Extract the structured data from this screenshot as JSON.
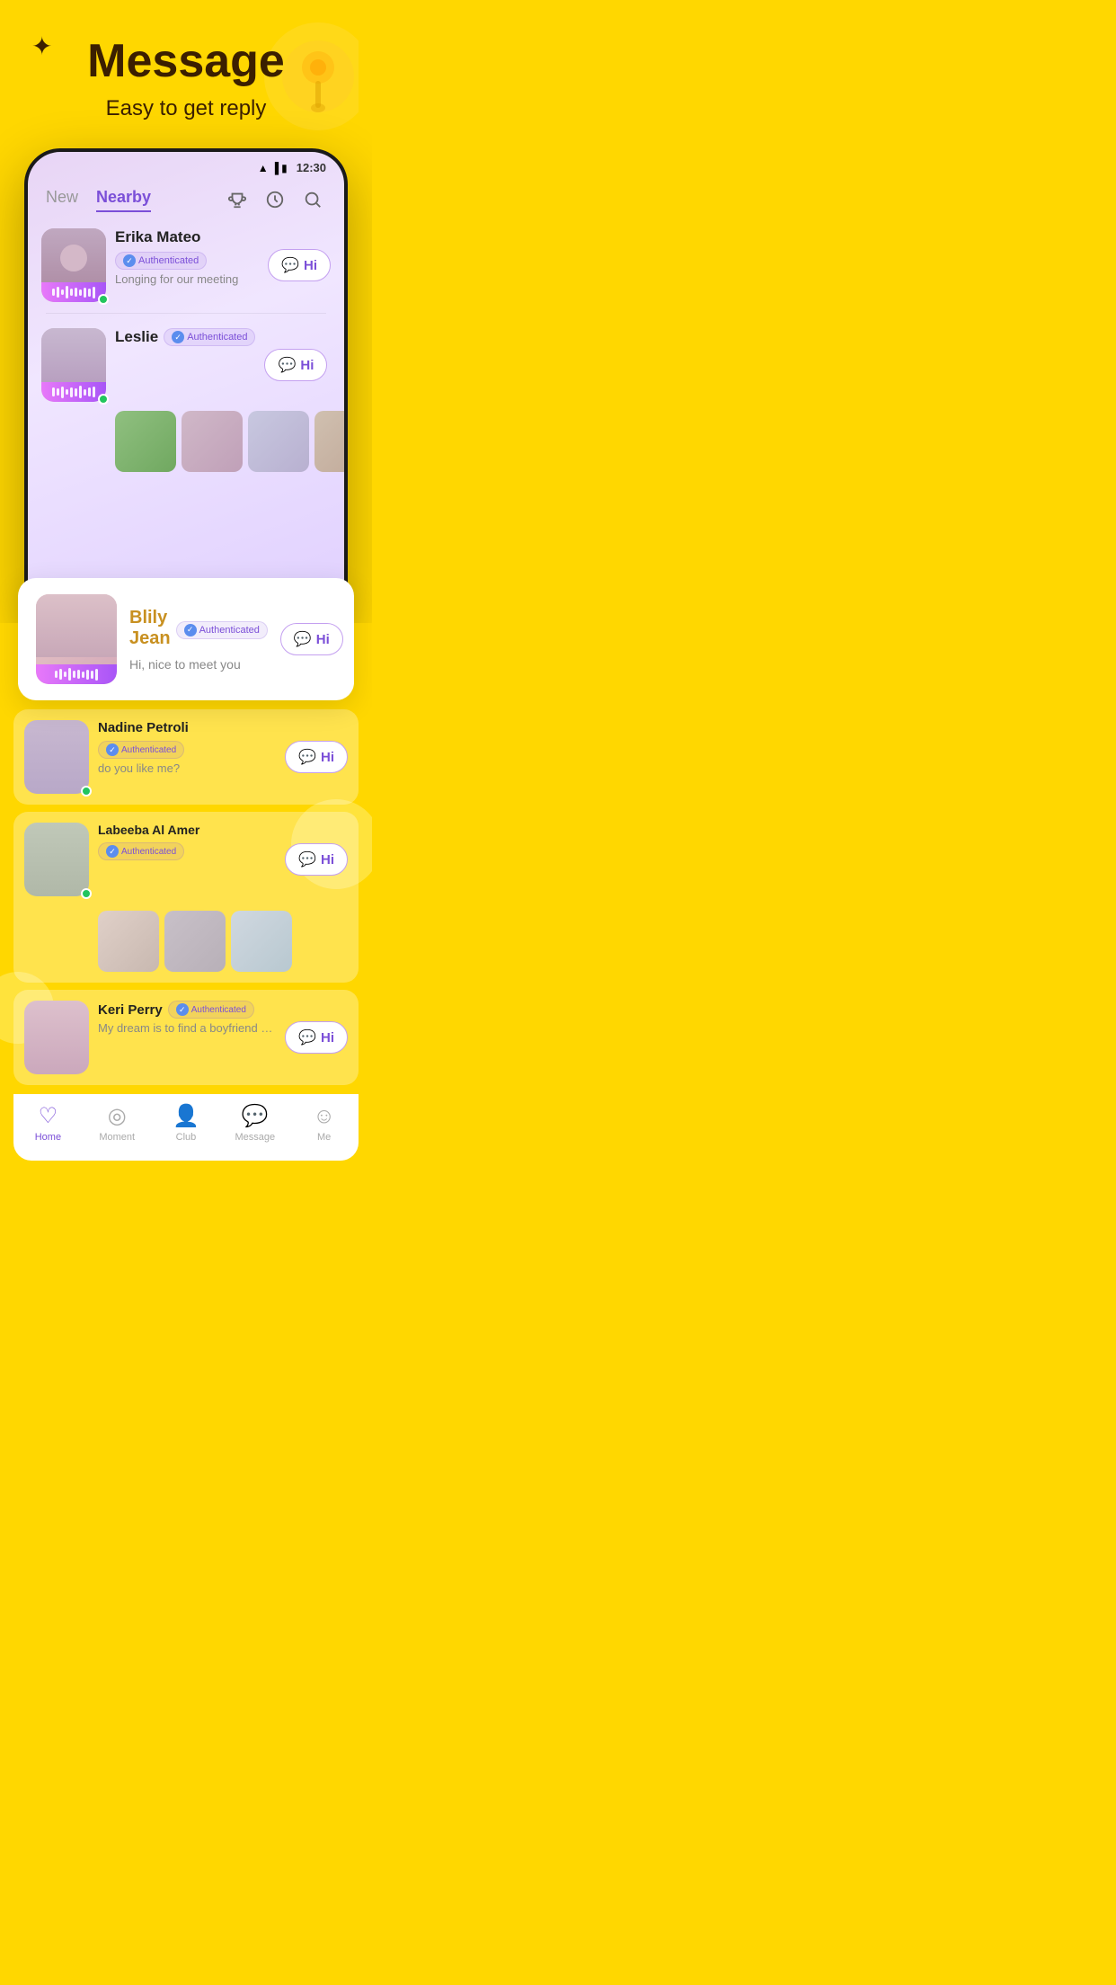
{
  "hero": {
    "title": "Message",
    "subtitle": "Easy to get reply"
  },
  "status_bar": {
    "time": "12:30",
    "wifi": "▲",
    "signal": "▐",
    "battery": "🔋"
  },
  "tabs": {
    "items": [
      {
        "label": "New",
        "active": false
      },
      {
        "label": "Nearby",
        "active": true
      }
    ],
    "icons": [
      "trophy",
      "clock",
      "search"
    ]
  },
  "users": [
    {
      "name": "Erika Mateo",
      "authenticated": true,
      "status": "Longing for our meeting",
      "online": true,
      "has_photos": false,
      "avatar_color": "linear-gradient(135deg, #d4b8c8, #c8a0b5)"
    },
    {
      "name": "Leslie",
      "authenticated": true,
      "status": "",
      "online": true,
      "has_photos": true,
      "avatar_color": "linear-gradient(135deg, #e0c8d8, #c8b0c8)"
    },
    {
      "name": "Blily Jean",
      "authenticated": true,
      "status": "Hi, nice to meet you",
      "online": false,
      "has_photos": false,
      "floating": true,
      "avatar_color": "linear-gradient(135deg, #e8c8c8, #d4a8b0)"
    },
    {
      "name": "Nadine Petroli",
      "authenticated": true,
      "status": "do you like me?",
      "online": true,
      "has_photos": false,
      "avatar_color": "linear-gradient(135deg, #c8c8e0, #b8b0d0)"
    },
    {
      "name": "Labeeba Al Amer",
      "authenticated": true,
      "status": "",
      "online": true,
      "has_photos": true,
      "avatar_color": "linear-gradient(135deg, #c8d4c8, #b0c4b0)"
    },
    {
      "name": "Keri Perry",
      "authenticated": true,
      "status": "My dream is to find a boyfriend who l...",
      "online": false,
      "has_photos": false,
      "avatar_color": "linear-gradient(135deg, #e0c8d8, #d0b0c8)"
    }
  ],
  "auth_label": "Authenticated",
  "hi_label": "Hi",
  "bottom_nav": [
    {
      "label": "Home",
      "icon": "♡",
      "active": true
    },
    {
      "label": "Moment",
      "icon": "◎",
      "active": false
    },
    {
      "label": "Club",
      "icon": "👤",
      "active": false
    },
    {
      "label": "Message",
      "icon": "💬",
      "active": false
    },
    {
      "label": "Me",
      "icon": "☺",
      "active": false
    }
  ]
}
